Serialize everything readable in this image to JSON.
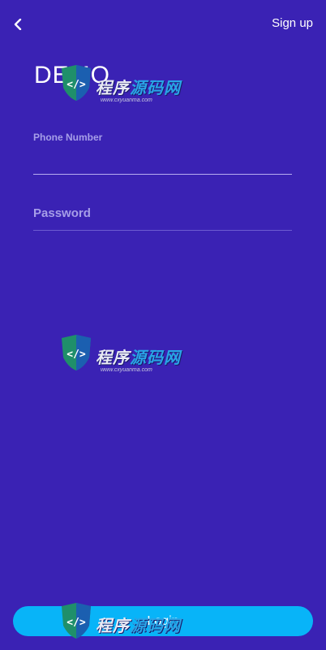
{
  "header": {
    "back_icon": "chevron-left-icon",
    "signup_label": "Sign up"
  },
  "app": {
    "title": "DEMO"
  },
  "form": {
    "phone_label": "Phone Number",
    "phone_value": "",
    "password_label": "Password",
    "password_value": ""
  },
  "actions": {
    "login_label": "Login"
  },
  "watermark": {
    "text_main": "程序",
    "text_accent": "源码网",
    "url": "www.cxyuanma.com"
  },
  "colors": {
    "background": "#3a22b4",
    "login_button": "#08b4f8",
    "label": "#a69ee8"
  }
}
